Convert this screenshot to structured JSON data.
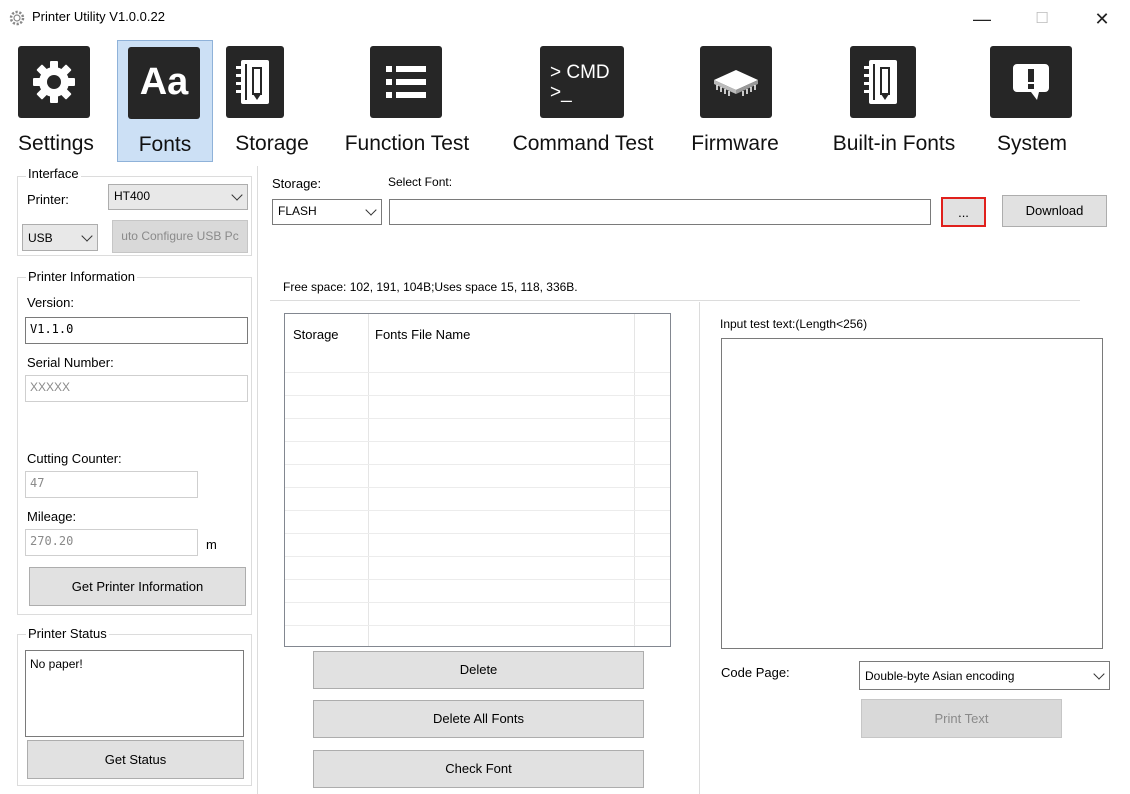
{
  "window": {
    "title": "Printer Utility  V1.0.0.22",
    "minimize_glyph": "—",
    "maximize_glyph": "☐",
    "close_glyph": "✕"
  },
  "toolbar": {
    "items": [
      {
        "label": "Settings",
        "icon": "gear-icon"
      },
      {
        "label": "Fonts",
        "icon": "font-aa-icon",
        "active": true
      },
      {
        "label": "Storage",
        "icon": "notebook-pencil-icon"
      },
      {
        "label": "Function Test",
        "icon": "list-icon"
      },
      {
        "label": "Command Test",
        "icon": "cmd-prompt-icon"
      },
      {
        "label": "Firmware",
        "icon": "chip-icon"
      },
      {
        "label": "Built-in Fonts",
        "icon": "notebook-pencil-icon"
      },
      {
        "label": "System",
        "icon": "alert-bubble-icon"
      }
    ],
    "cmd_icon_text_line1": "> CMD",
    "cmd_icon_text_line2": ">_",
    "aa_icon_text": "Aa"
  },
  "interface": {
    "legend": "Interface",
    "printer_label": "Printer:",
    "printer_value": "HT400",
    "port_value": "USB",
    "auto_config_button": "uto Configure USB Pc"
  },
  "printer_info": {
    "legend": "Printer Information",
    "version_label": "Version:",
    "version_value": "V1.1.0",
    "serial_label": "Serial Number:",
    "serial_value": "XXXXX",
    "cutting_label": "Cutting Counter:",
    "cutting_value": "47",
    "mileage_label": "Mileage:",
    "mileage_value": "270.20",
    "mileage_unit": "m",
    "get_info_button": "Get Printer Information"
  },
  "printer_status": {
    "legend": "Printer Status",
    "status_text": "No paper!",
    "get_status_button": "Get Status"
  },
  "fonts": {
    "storage_label": "Storage:",
    "storage_value": "FLASH",
    "select_font_label": "Select Font:",
    "font_path_value": "",
    "browse_button": "...",
    "download_button": "Download",
    "free_space_text": "Free space: 102, 191, 104B;Uses space 15, 118, 336B.",
    "table": {
      "columns": [
        "Storage",
        "Fonts File Name"
      ],
      "rows": []
    },
    "delete_button": "Delete",
    "delete_all_button": "Delete All Fonts",
    "check_font_button": "Check Font",
    "input_label": "Input test text:(Length<256)",
    "input_value": "",
    "code_page_label": "Code Page:",
    "code_page_value": "Double-byte Asian encoding",
    "print_text_button": "Print Text",
    "highlight_color": "#e0201c"
  }
}
